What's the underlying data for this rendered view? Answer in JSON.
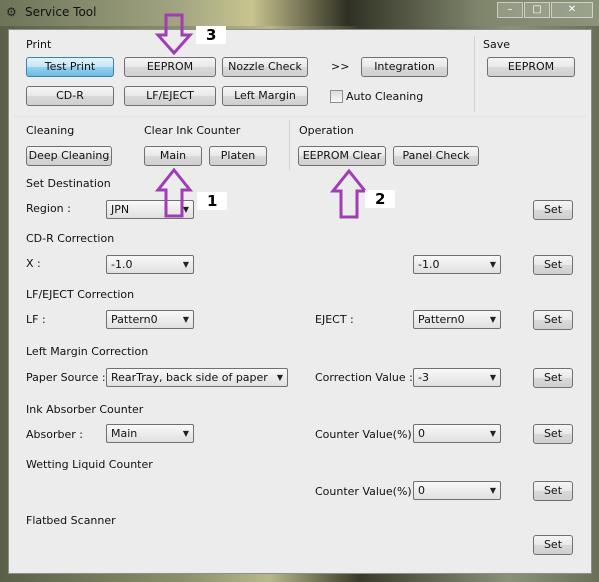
{
  "window": {
    "title": "Service Tool",
    "controls": {
      "minimize": "–",
      "maximize": "□",
      "close": "✕"
    }
  },
  "print": {
    "label": "Print",
    "buttons": {
      "test_print": "Test Print",
      "eeprom": "EEPROM",
      "nozzle_check": "Nozzle Check",
      "cd_r": "CD-R",
      "lf_eject": "LF/EJECT",
      "left_margin": "Left Margin"
    },
    "chevrons": ">>",
    "integration": "Integration",
    "auto_cleaning": {
      "label": "Auto Cleaning",
      "checked": false
    }
  },
  "save": {
    "label": "Save",
    "eeprom": "EEPROM"
  },
  "cleaning": {
    "label": "Cleaning",
    "deep_cleaning": "Deep Cleaning"
  },
  "clear_ink_counter": {
    "label": "Clear Ink Counter",
    "main": "Main",
    "platen": "Platen"
  },
  "operation": {
    "label": "Operation",
    "eeprom_clear": "EEPROM Clear",
    "panel_check": "Panel Check"
  },
  "set_destination": {
    "label": "Set Destination",
    "region_label": "Region :",
    "region_value": "JPN",
    "set": "Set"
  },
  "cdr_correction": {
    "label": "CD-R Correction",
    "x_label": "X :",
    "x_value": "-1.0",
    "y_value": "-1.0",
    "set": "Set"
  },
  "lf_eject_correction": {
    "label": "LF/EJECT Correction",
    "lf_label": "LF :",
    "lf_value": "Pattern0",
    "eject_label": "EJECT :",
    "eject_value": "Pattern0",
    "set": "Set"
  },
  "left_margin_correction": {
    "label": "Left Margin Correction",
    "paper_source_label": "Paper Source :",
    "paper_source_value": "RearTray, back side of paper",
    "correction_label": "Correction Value :",
    "correction_value": "-3",
    "set": "Set"
  },
  "ink_absorber_counter": {
    "label": "Ink Absorber Counter",
    "absorber_label": "Absorber :",
    "absorber_value": "Main",
    "counter_label": "Counter Value(%) :",
    "counter_value": "0",
    "set": "Set"
  },
  "wetting_liquid_counter": {
    "label": "Wetting Liquid Counter",
    "counter_label": "Counter Value(%) :",
    "counter_value": "0",
    "set": "Set"
  },
  "flatbed_scanner": {
    "label": "Flatbed Scanner",
    "set": "Set"
  },
  "annotations": {
    "a1": "1",
    "a2": "2",
    "a3": "3",
    "color": "#a03cb4"
  }
}
